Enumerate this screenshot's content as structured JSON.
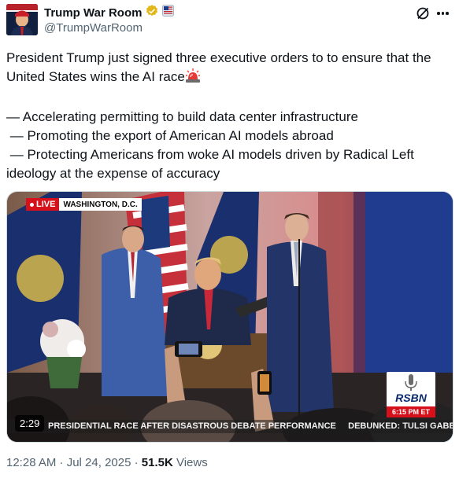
{
  "tweet": {
    "author": {
      "display_name": "Trump War Room",
      "handle": "@TrumpWarRoom"
    },
    "paragraph1": "President Trump just signed three executive orders to to ensure that the United States wins the AI race",
    "bullet1": "— Accelerating permitting to build data center infrastructure",
    "bullet2": " — Promoting the export of American AI models abroad",
    "bullet3": " — Protecting Americans from woke AI models driven by Radical Left ideology at the expense of accuracy",
    "media": {
      "live_label": "LIVE",
      "location": "WASHINGTON, D.C.",
      "channel": "RSBN",
      "channel_time": "6:15 PM ET",
      "ticker": "PRESIDENTIAL RACE AFTER DISASTROUS DEBATE PERFORMANCE     DEBUNKED: TULSI GABB",
      "duration": "2:29"
    },
    "timestamp": "12:28 AM · Jul 24, 2025",
    "separator": " · ",
    "views_count": "51.5K",
    "views_label": "Views"
  },
  "colors": {
    "verified_gold": "#e2b719",
    "text": "#0f1419",
    "secondary": "#536471",
    "live_red": "#d7111b"
  },
  "icons": [
    "avatar",
    "verified-gold-icon",
    "flag-badge-icon",
    "grok-icon",
    "more-icon",
    "siren-icon"
  ]
}
